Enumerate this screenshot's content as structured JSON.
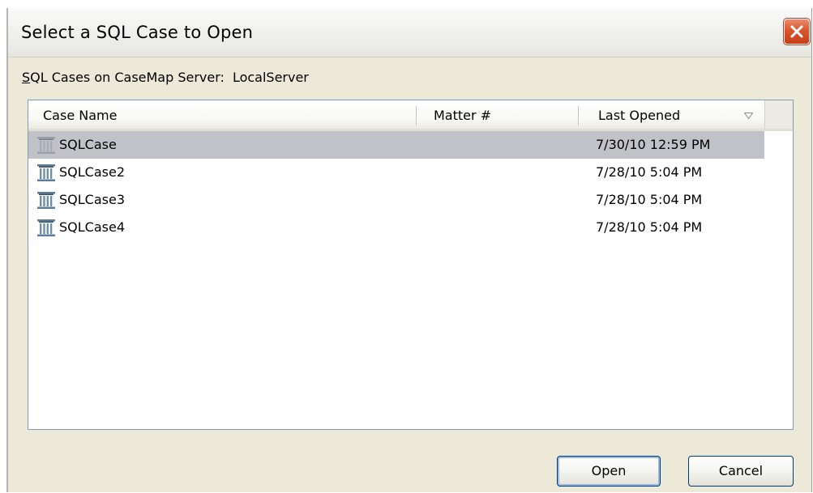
{
  "window": {
    "title": "Select a SQL Case to Open"
  },
  "server": {
    "label_first": "S",
    "label_rest": "QL Cases on CaseMap Server:",
    "name": "LocalServer"
  },
  "columns": {
    "case_name": "Case Name",
    "matter": "Matter #",
    "last_opened": "Last Opened"
  },
  "rows": [
    {
      "name": "SQLCase",
      "matter": "",
      "last_opened": "7/30/10 12:59 PM",
      "selected": true
    },
    {
      "name": "SQLCase2",
      "matter": "",
      "last_opened": "7/28/10 5:04 PM",
      "selected": false
    },
    {
      "name": "SQLCase3",
      "matter": "",
      "last_opened": "7/28/10 5:04 PM",
      "selected": false
    },
    {
      "name": "SQLCase4",
      "matter": "",
      "last_opened": "7/28/10 5:04 PM",
      "selected": false
    }
  ],
  "buttons": {
    "open": "Open",
    "cancel": "Cancel"
  },
  "colors": {
    "selection": "#c1c1c8",
    "close_button": "#d8562e",
    "list_border": "#7f9db9"
  },
  "icons": {
    "row_icon": "database-pillar-icon",
    "close": "close-icon",
    "sort": "sort-descending-icon"
  }
}
